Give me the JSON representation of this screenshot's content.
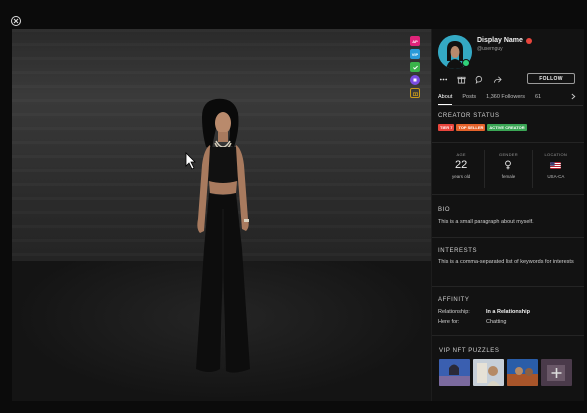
{
  "window": {
    "close_icon": "close-circle-icon"
  },
  "scene": {
    "side_badges": [
      {
        "label": "AP",
        "color": "#e0247a"
      },
      {
        "label": "VIP",
        "color": "#2a9ad8"
      },
      {
        "label": "",
        "color": "#3bb34a",
        "icon": "check-icon"
      },
      {
        "label": "",
        "color": "#7a4de0",
        "icon": "cube-icon"
      },
      {
        "label": "",
        "color": "#c99a1a",
        "icon": "gift-outline-icon"
      }
    ]
  },
  "profile": {
    "display_name": "Display Name",
    "username": "@usernguy",
    "online_color": "#2fd37a",
    "follow_label": "FOLLOW",
    "action_icons": [
      "more-icon",
      "gift-icon",
      "chat-icon",
      "share-icon"
    ]
  },
  "tabs": [
    "About",
    "Posts",
    "1,360 Followers",
    "61"
  ],
  "creator_status": {
    "title": "CREATOR STATUS",
    "tags": [
      {
        "label": "TIER 7",
        "color": "#e8453c"
      },
      {
        "label": "TOP SELLER",
        "color": "#e5622a"
      },
      {
        "label": "ACTIVE CREATOR",
        "color": "#3aa655"
      }
    ]
  },
  "stats": [
    {
      "label": "AGE",
      "value": "22",
      "sub": "years old"
    },
    {
      "label": "GENDER",
      "icon": "female-symbol-icon",
      "sub": "female"
    },
    {
      "label": "LOCATION",
      "icon": "us-flag-icon",
      "sub": "USA-CA"
    }
  ],
  "bio": {
    "title": "BIO",
    "text": "This is a small paragraph about myself."
  },
  "interests": {
    "title": "INTERESTS",
    "text": "This is a comma-separated list of keywords for interests"
  },
  "affinity": {
    "title": "AFFINITY",
    "rows": [
      {
        "key": "Relationship:",
        "value": "In a Relationship"
      },
      {
        "key": "Here for:",
        "value": "Chatting"
      }
    ]
  },
  "nft": {
    "title": "VIP NFT PUZZLES"
  }
}
